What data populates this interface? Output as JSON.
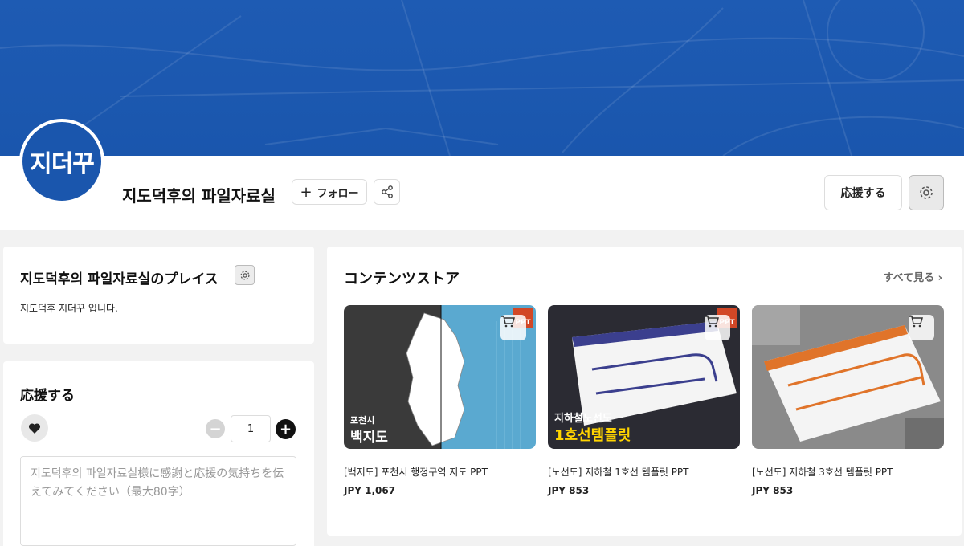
{
  "profile": {
    "avatar_text": "지더꾸",
    "name": "지도덕후의 파일자료실",
    "follow_label": "フォロー",
    "support_label": "応援する"
  },
  "place": {
    "title": "지도덕후의 파일자료실のプレイス",
    "description": "지도덕후 지더꾸 입니다."
  },
  "support": {
    "title": "応援する",
    "quantity": "1",
    "message_placeholder": "지도덕후의 파일자료실様に感謝と応援の気持ちを伝えてみてください（最大80字）"
  },
  "store": {
    "title": "コンテンツストア",
    "see_all": "すべて見る",
    "products": [
      {
        "name": "[백지도] 포천시 행정구역 지도 PPT",
        "price": "JPY 1,067",
        "badge": "PPT",
        "caption_small": "포천시",
        "caption_large": "백지도"
      },
      {
        "name": "[노선도] 지하철 1호선 템플릿 PPT",
        "price": "JPY 853",
        "badge": "PPT",
        "caption_small": "지하철노선도",
        "caption_large": "1호선템플릿"
      },
      {
        "name": "[노선도] 지하철 3호선 템플릿 PPT",
        "price": "JPY 853"
      }
    ]
  },
  "colors": {
    "brand_blue": "#1a56ad",
    "ppt_orange": "#d24726"
  }
}
